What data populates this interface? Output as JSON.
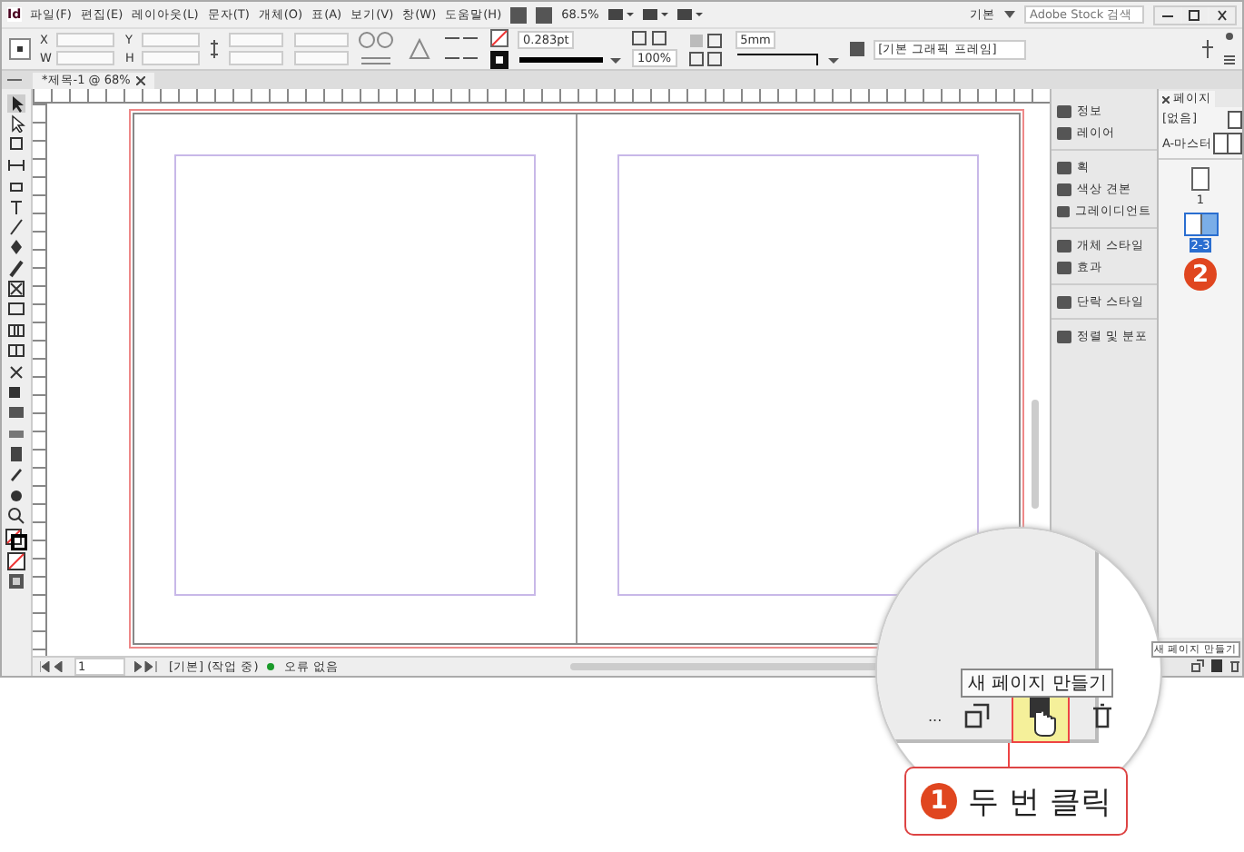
{
  "window": {
    "app_logo": "Id",
    "menu": [
      "파일(F)",
      "편집(E)",
      "레이아웃(L)",
      "문자(T)",
      "개체(O)",
      "표(A)",
      "보기(V)",
      "창(W)",
      "도움말(H)"
    ],
    "zoom": "68.5%",
    "workspace": "기본",
    "search": {
      "placeholder": "Adobe Stock 검색"
    }
  },
  "control_panel": {
    "fields": [
      {
        "label": "X"
      },
      {
        "label": "Y"
      },
      {
        "label": "W"
      },
      {
        "label": "H"
      }
    ],
    "stroke_weight": "0.283pt",
    "opacity": "100%",
    "dimension": "5mm",
    "style": "[기본 그래픽 프레임]"
  },
  "document_tab": {
    "title": "*제목-1 @ 68%",
    "selected": true
  },
  "panel_dock": [
    {
      "label": "정보"
    },
    {
      "label": "레이어"
    },
    {
      "label": "획"
    },
    {
      "label": "색상 견본"
    },
    {
      "label": "그레이디언트"
    },
    {
      "label": "개체 스타일"
    },
    {
      "label": "효과"
    },
    {
      "label": "단락 스타일"
    },
    {
      "label": "정렬 및 분포"
    }
  ],
  "pages_panel": {
    "tab": "페이지",
    "masters": [
      {
        "label": "[없음]"
      },
      {
        "label": "A-마스터"
      }
    ],
    "pages": [
      {
        "label": "1",
        "selected": false
      },
      {
        "label": "2-3",
        "selected": true
      }
    ],
    "tooltip": "새 페이지 만들기"
  },
  "status_bar": {
    "page": "1",
    "profile": "[기본] (작업 중)",
    "preflight": "오류 없음",
    "preflight_ok": true
  },
  "magnifier": {
    "tooltip": "새 페이지 만들기",
    "more": "..."
  },
  "callouts": [
    {
      "number": "1",
      "text": "두 번 클릭"
    },
    {
      "number": "2"
    }
  ]
}
